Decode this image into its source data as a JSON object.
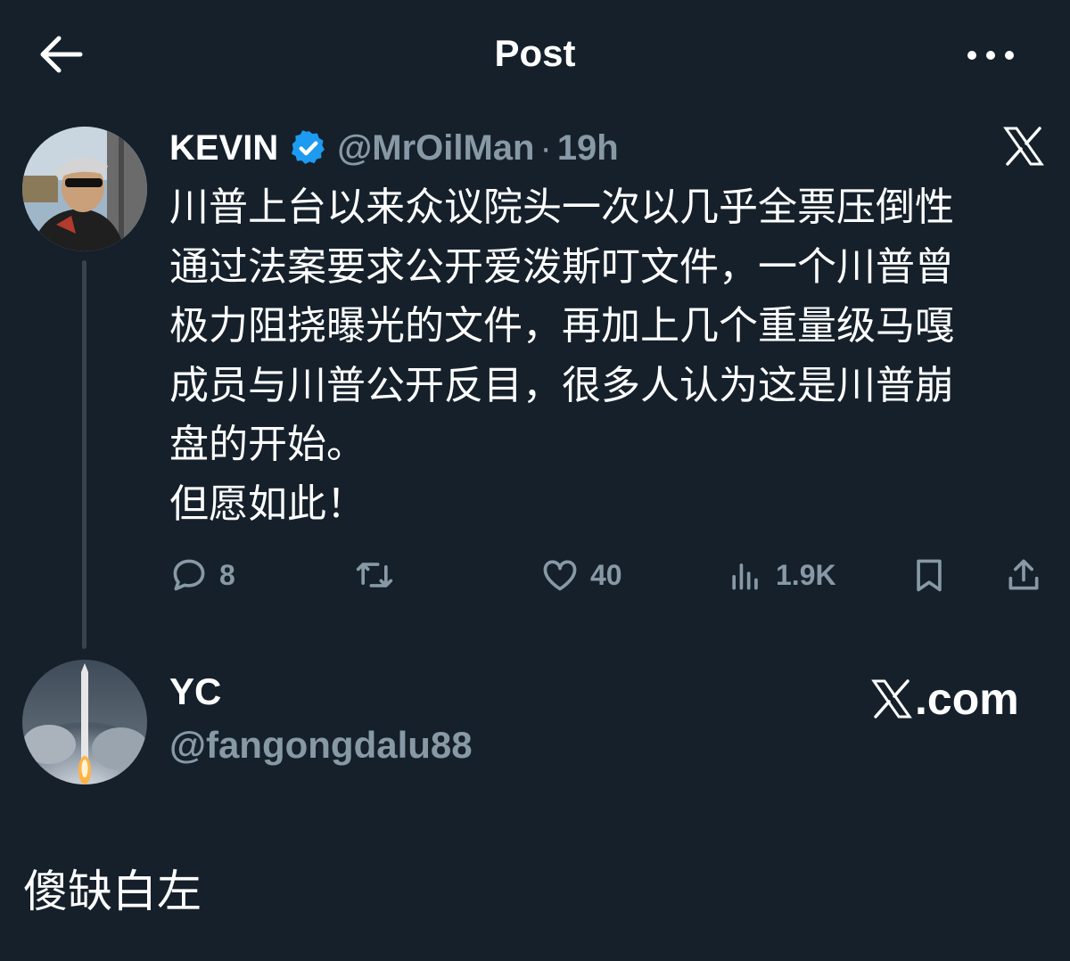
{
  "header": {
    "title": "Post",
    "back_icon": "arrow-left-icon",
    "more_icon": "more-horizontal-icon"
  },
  "tweet": {
    "display_name": "KEVIN",
    "verified_icon": "verified-badge-icon",
    "handle": "@MrOilMan",
    "separator": "·",
    "time": "19h",
    "brand_icon": "x-logo-icon",
    "text": "川普上台以来众议院头一次以几乎全票压倒性\n通过法案要求公开爱泼斯叮文件，一个川普曾\n极力阻挠曝光的文件，再加上几个重量级马嘎\n成员与川普公开反目，很多人认为这是川普崩\n盘的开始。\n但愿如此！",
    "actions": {
      "reply_count": "8",
      "like_count": "40",
      "views_count": "1.9K"
    }
  },
  "reply": {
    "display_name": "YC",
    "handle": "@fangongdalu88",
    "site_label": ".com",
    "text": "傻缺白左"
  },
  "colors": {
    "background": "#15202b",
    "verified": "#1d9bf0",
    "muted": "#8899a6"
  }
}
